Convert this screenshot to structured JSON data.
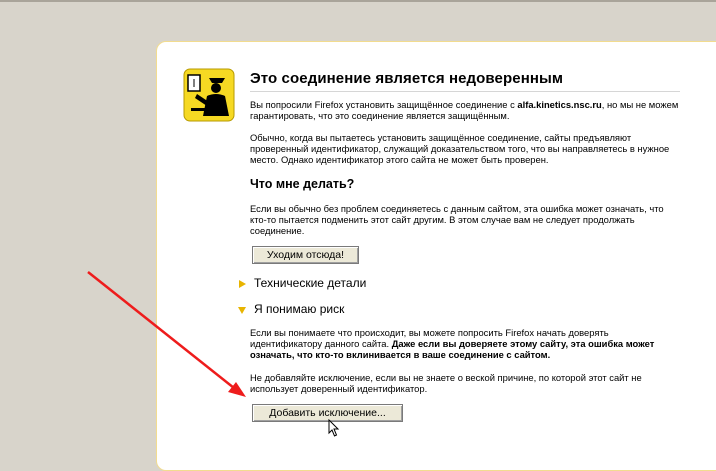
{
  "page": {
    "title": "Это соединение является недоверенным",
    "intro_prefix": "Вы попросили Firefox установить защищённое соединение с ",
    "intro_host": "alfa.kinetics.nsc.ru",
    "intro_suffix": ", но мы не можем гарантировать, что это соединение является защищённым.",
    "explanation": "Обычно, когда вы пытаетесь установить защищённое соединение, сайты предъявляют проверенный идентификатор, служащий доказательством того, что вы направляетесь в нужное место. Однако идентификатор этого сайта не может быть проверен.",
    "what_to_do_heading": "Что мне делать?",
    "what_to_do_text": "Если вы обычно без проблем соединяетесь с данным сайтом, эта ошибка может означать, что кто-то пытается подменить этот сайт другим. В этом случае вам не следует продолжать соединение.",
    "leave_button": "Уходим отсюда!",
    "technical_details": "Технические детали",
    "understand_risks": "Я понимаю риск",
    "risk_text_plain": "Если вы понимаете что происходит, вы можете попросить Firefox начать доверять идентификатору данного сайта. ",
    "risk_text_bold": "Даже если вы доверяете этому сайту, эта ошибка может означать, что кто-то вклинивается в ваше соединение с сайтом.",
    "exception_warning": "Не добавляйте исключение, если вы не знаете о веской причине, по которой этот сайт не использует доверенный идентификатор.",
    "add_exception_button": "Добавить исключение..."
  },
  "colors": {
    "background": "#d8d4cb",
    "card_border": "#f2dc8f",
    "badge": "#f6d923",
    "arrow": "#ee1c1c",
    "triangle": "#e8b400"
  },
  "icons": [
    "police-officer-icon",
    "triangle-right-icon",
    "triangle-down-icon",
    "mouse-cursor-icon",
    "red-arrow-annotation"
  ]
}
